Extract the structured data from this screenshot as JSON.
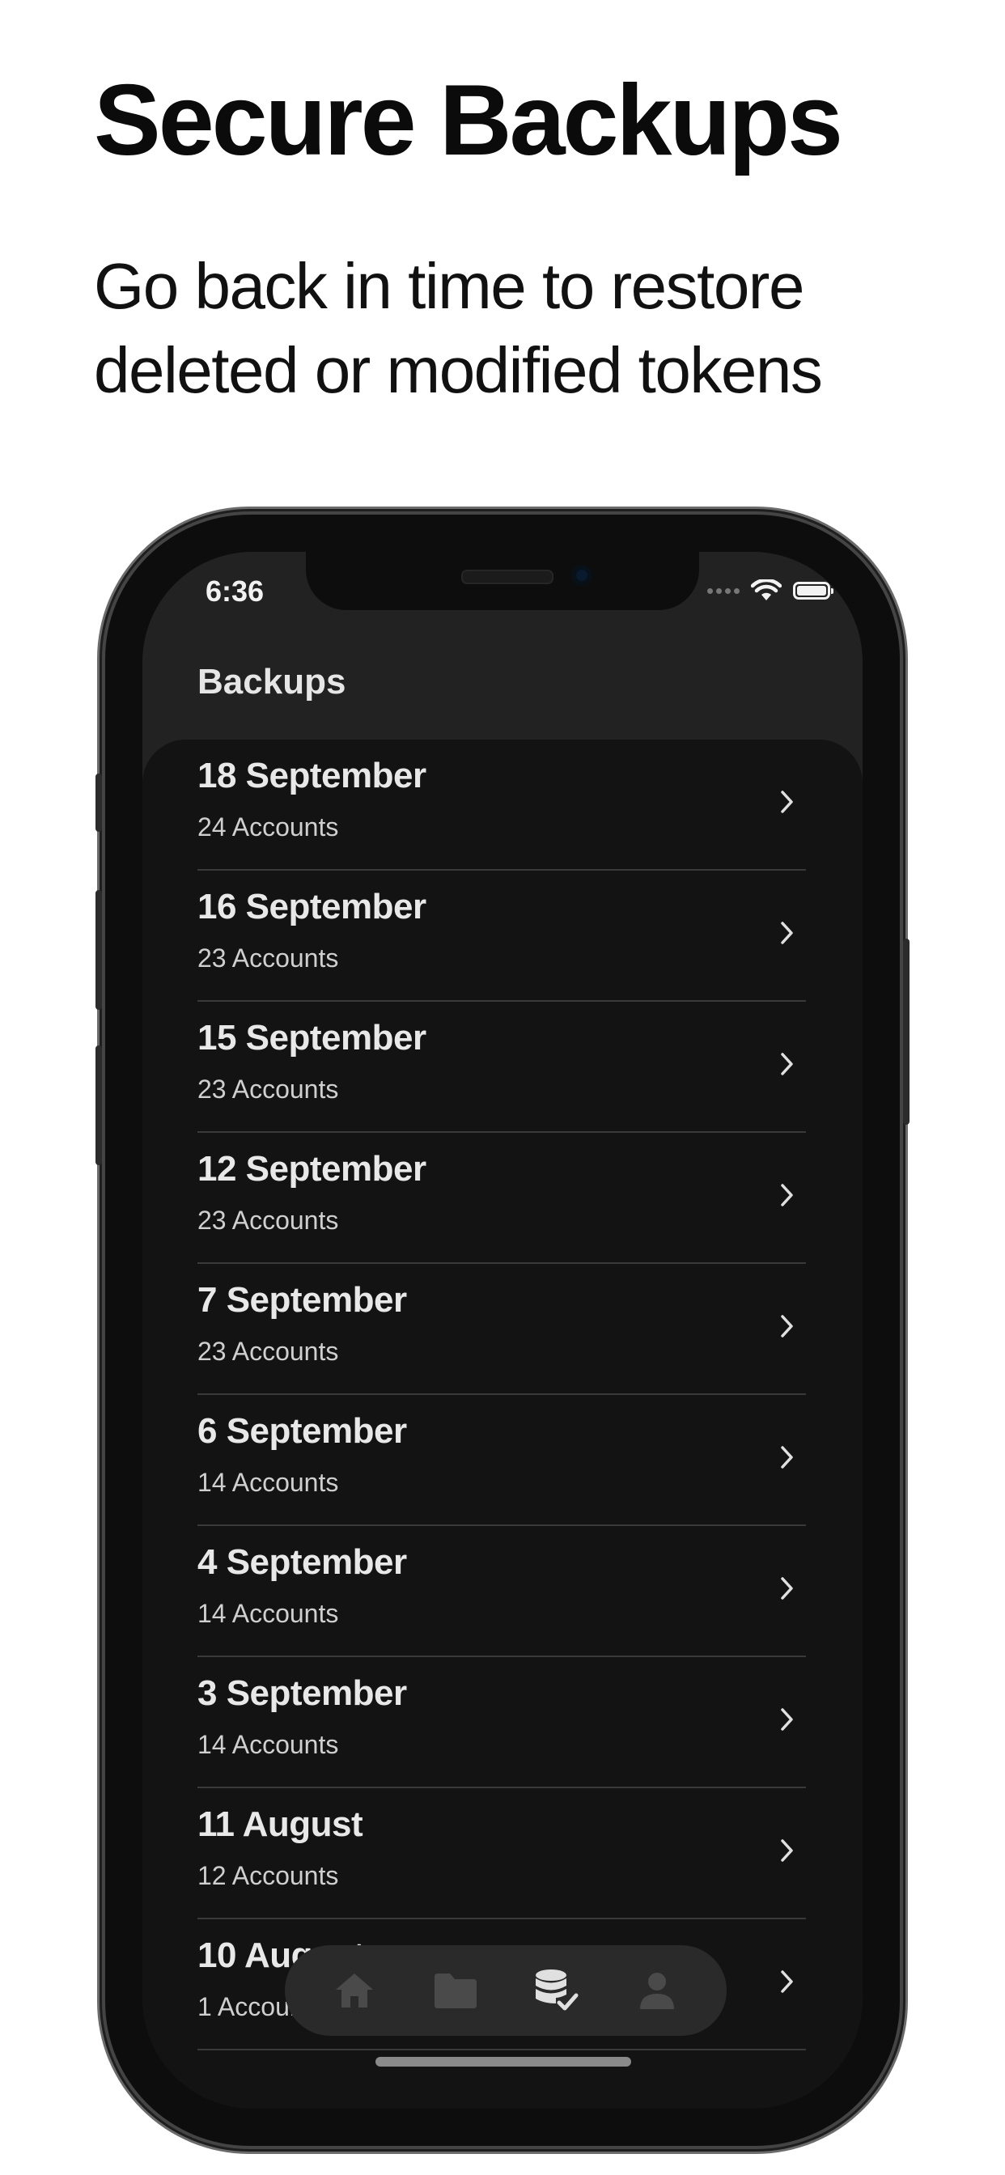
{
  "marketing": {
    "headline": "Secure Backups",
    "subheadline_line1": "Go back in time to restore",
    "subheadline_line2": "deleted or modified tokens"
  },
  "status_bar": {
    "time": "6:36",
    "icons": [
      "signal-dots-icon",
      "wifi-icon",
      "battery-icon"
    ]
  },
  "nav": {
    "title": "Backups"
  },
  "backups": [
    {
      "date": "18 September",
      "accounts": "24 Accounts"
    },
    {
      "date": "16 September",
      "accounts": "23 Accounts"
    },
    {
      "date": "15 September",
      "accounts": "23 Accounts"
    },
    {
      "date": "12 September",
      "accounts": "23 Accounts"
    },
    {
      "date": "7 September",
      "accounts": "23 Accounts"
    },
    {
      "date": "6 September",
      "accounts": "14 Accounts"
    },
    {
      "date": "4 September",
      "accounts": "14 Accounts"
    },
    {
      "date": "3 September",
      "accounts": "14 Accounts"
    },
    {
      "date": "11 August",
      "accounts": "12 Accounts"
    },
    {
      "date": "10 August",
      "accounts": "1 Accounts"
    }
  ],
  "tabbar": {
    "tabs": [
      {
        "icon": "home-icon",
        "active": false
      },
      {
        "icon": "folder-icon",
        "active": false
      },
      {
        "icon": "database-check-icon",
        "active": true
      },
      {
        "icon": "person-icon",
        "active": false
      }
    ]
  },
  "colors": {
    "page_background": "#ffffff",
    "app_background": "#141414",
    "nav_background": "#222222",
    "divider": "#3a3a3a",
    "tab_active": "#e0e0e0",
    "tab_inactive": "#4a4a4a"
  }
}
